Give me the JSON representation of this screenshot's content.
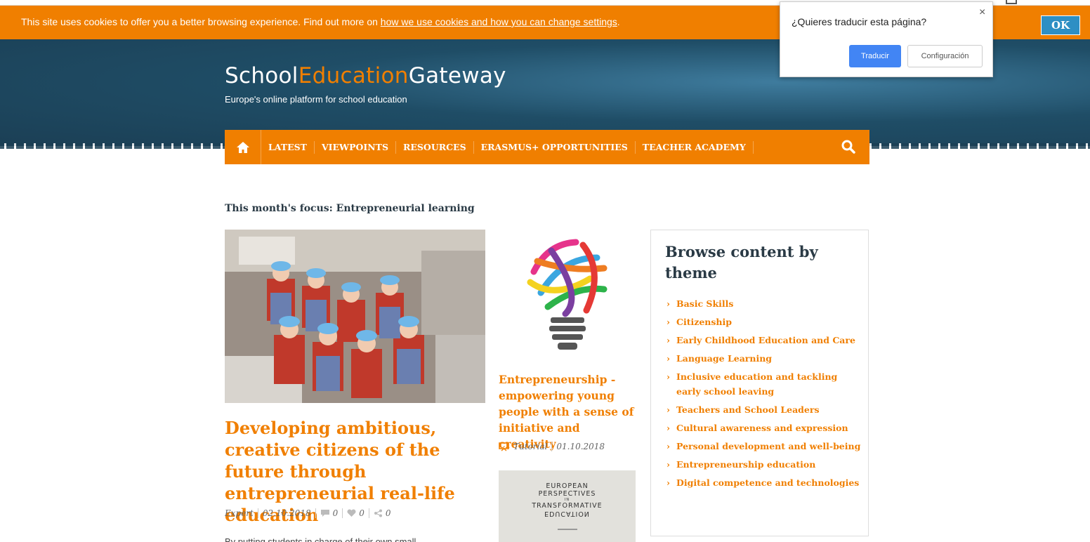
{
  "cookie_banner": {
    "text": "This site uses cookies to offer you a better browsing experience. Find out more on ",
    "link": "how we use cookies and how you can change settings",
    "after": ".",
    "ok_label": "OK"
  },
  "translate_popup": {
    "question": "¿Quieres traducir esta página?",
    "close": "×",
    "translate_label": "Traducir",
    "settings_label": "Configuración"
  },
  "header": {
    "logo_part1": "School",
    "logo_part2": "Education",
    "logo_part3": "Gateway",
    "tagline": "Europe's online platform for school education"
  },
  "nav": {
    "items": [
      "LATEST",
      "VIEWPOINTS",
      "RESOURCES",
      "ERASMUS+ OPPORTUNITIES",
      "TEACHER ACADEMY"
    ]
  },
  "main": {
    "focus_heading": "This month's focus: Entrepreneurial learning",
    "featured": {
      "title": "Developing ambitious, creative citizens of the future through entrepreneurial real-life education",
      "type": "Expert",
      "date": "02.10.2018",
      "comments": "0",
      "likes": "0",
      "shares": "0",
      "excerpt": "By putting students in charge of their own small"
    },
    "tutorial": {
      "title": "Entrepreneurship - empowering young people with a sense of initiative and creativity",
      "type": "Tutorial",
      "date": "01.10.2018"
    },
    "book": {
      "line1": "EUROPEAN",
      "line2": "PERSPECTIVES",
      "line3": "IN",
      "line4": "TRANSFORMATIVE",
      "line5": "EDUCATION"
    }
  },
  "browse": {
    "heading": "Browse content by theme",
    "items": [
      "Basic Skills",
      "Citizenship",
      "Early Childhood Education and Care",
      "Language Learning",
      "Inclusive education and tackling early school leaving",
      "Teachers and School Leaders",
      "Cultural awareness and expression",
      "Personal development and well-being",
      "Entrepreneurship education",
      "Digital competence and technologies"
    ]
  }
}
